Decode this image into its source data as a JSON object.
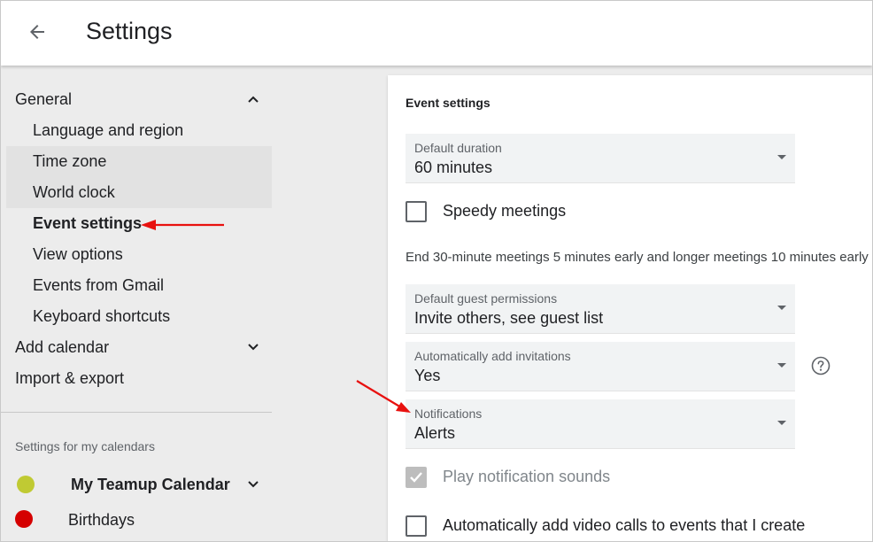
{
  "header": {
    "title": "Settings",
    "back_icon": "arrow-back-icon"
  },
  "sidebar": {
    "general": {
      "label": "General",
      "expanded": true
    },
    "items": [
      {
        "label": "Language and region",
        "highlight": false,
        "active": false
      },
      {
        "label": "Time zone",
        "highlight": true,
        "active": false
      },
      {
        "label": "World clock",
        "highlight": true,
        "active": false
      },
      {
        "label": "Event settings",
        "highlight": false,
        "active": true
      },
      {
        "label": "View options",
        "highlight": false,
        "active": false
      },
      {
        "label": "Events from Gmail",
        "highlight": false,
        "active": false
      },
      {
        "label": "Keyboard shortcuts",
        "highlight": false,
        "active": false
      }
    ],
    "add_calendar": {
      "label": "Add calendar",
      "expanded": false
    },
    "import_export": {
      "label": "Import & export"
    },
    "my_calendars_heading": "Settings for my calendars",
    "calendars": [
      {
        "label": "My Teamup Calendar",
        "color": "#c0ca33",
        "bold": true,
        "expandable": true
      },
      {
        "label": "Birthdays",
        "color": "#d50000",
        "bold": false,
        "expandable": false
      }
    ]
  },
  "main": {
    "heading": "Event settings",
    "default_duration": {
      "label": "Default duration",
      "value": "60 minutes"
    },
    "speedy_meetings": {
      "label": "Speedy meetings",
      "checked": false
    },
    "speedy_description": "End 30-minute meetings 5 minutes early and longer meetings 10 minutes early",
    "guest_permissions": {
      "label": "Default guest permissions",
      "value": "Invite others, see guest list"
    },
    "auto_invitations": {
      "label": "Automatically add invitations",
      "value": "Yes"
    },
    "notifications": {
      "label": "Notifications",
      "value": "Alerts"
    },
    "play_sounds": {
      "label": "Play notification sounds",
      "checked": true,
      "disabled": true
    },
    "video_calls": {
      "label": "Automatically add video calls to events that I create",
      "checked": false
    }
  },
  "colors": {
    "annotation_arrow": "#e8110f",
    "sidebar_bg": "#ececec",
    "highlight_bg": "#e2e2e2"
  }
}
